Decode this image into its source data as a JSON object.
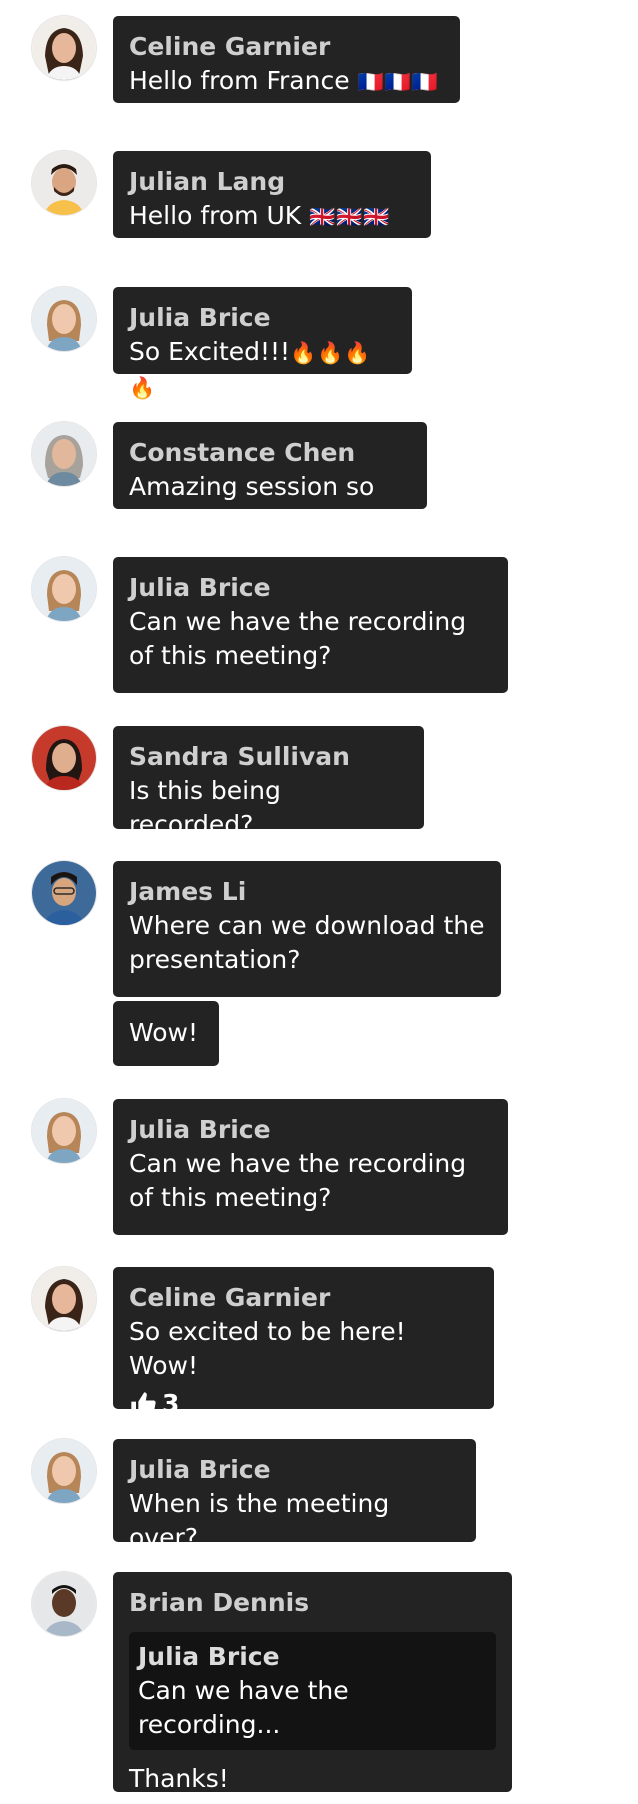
{
  "messages": [
    {
      "name": "Celine Garnier",
      "text": "Hello from France",
      "emoji": "🇫🇷🇫🇷🇫🇷"
    },
    {
      "name": "Julian Lang",
      "text": "Hello from UK",
      "emoji": "🇬🇧🇬🇧🇬🇧"
    },
    {
      "name": "Julia Brice",
      "text": "So Excited!!!",
      "emoji": "🔥🔥🔥🔥"
    },
    {
      "name": "Constance Chen",
      "text": "Amazing session so far"
    },
    {
      "name": "Julia Brice",
      "text": "Can we have the recording of this meeting?"
    },
    {
      "name": "Sandra Sullivan",
      "text": "Is this being recorded?"
    },
    {
      "name": "James Li",
      "text": "Where can we download the presentation?"
    },
    {
      "text": "Wow!"
    },
    {
      "name": "Julia Brice",
      "text": "Can we have the recording of this meeting?"
    },
    {
      "name": "Celine Garnier",
      "text": "So excited to be here! Wow!",
      "likes": "3"
    },
    {
      "name": "Julia Brice",
      "text": "When is the meeting over?"
    },
    {
      "name": "Brian Dennis",
      "quote": {
        "name": "Julia Brice",
        "text": "Can we have the recording..."
      },
      "text": "Thanks!"
    }
  ]
}
